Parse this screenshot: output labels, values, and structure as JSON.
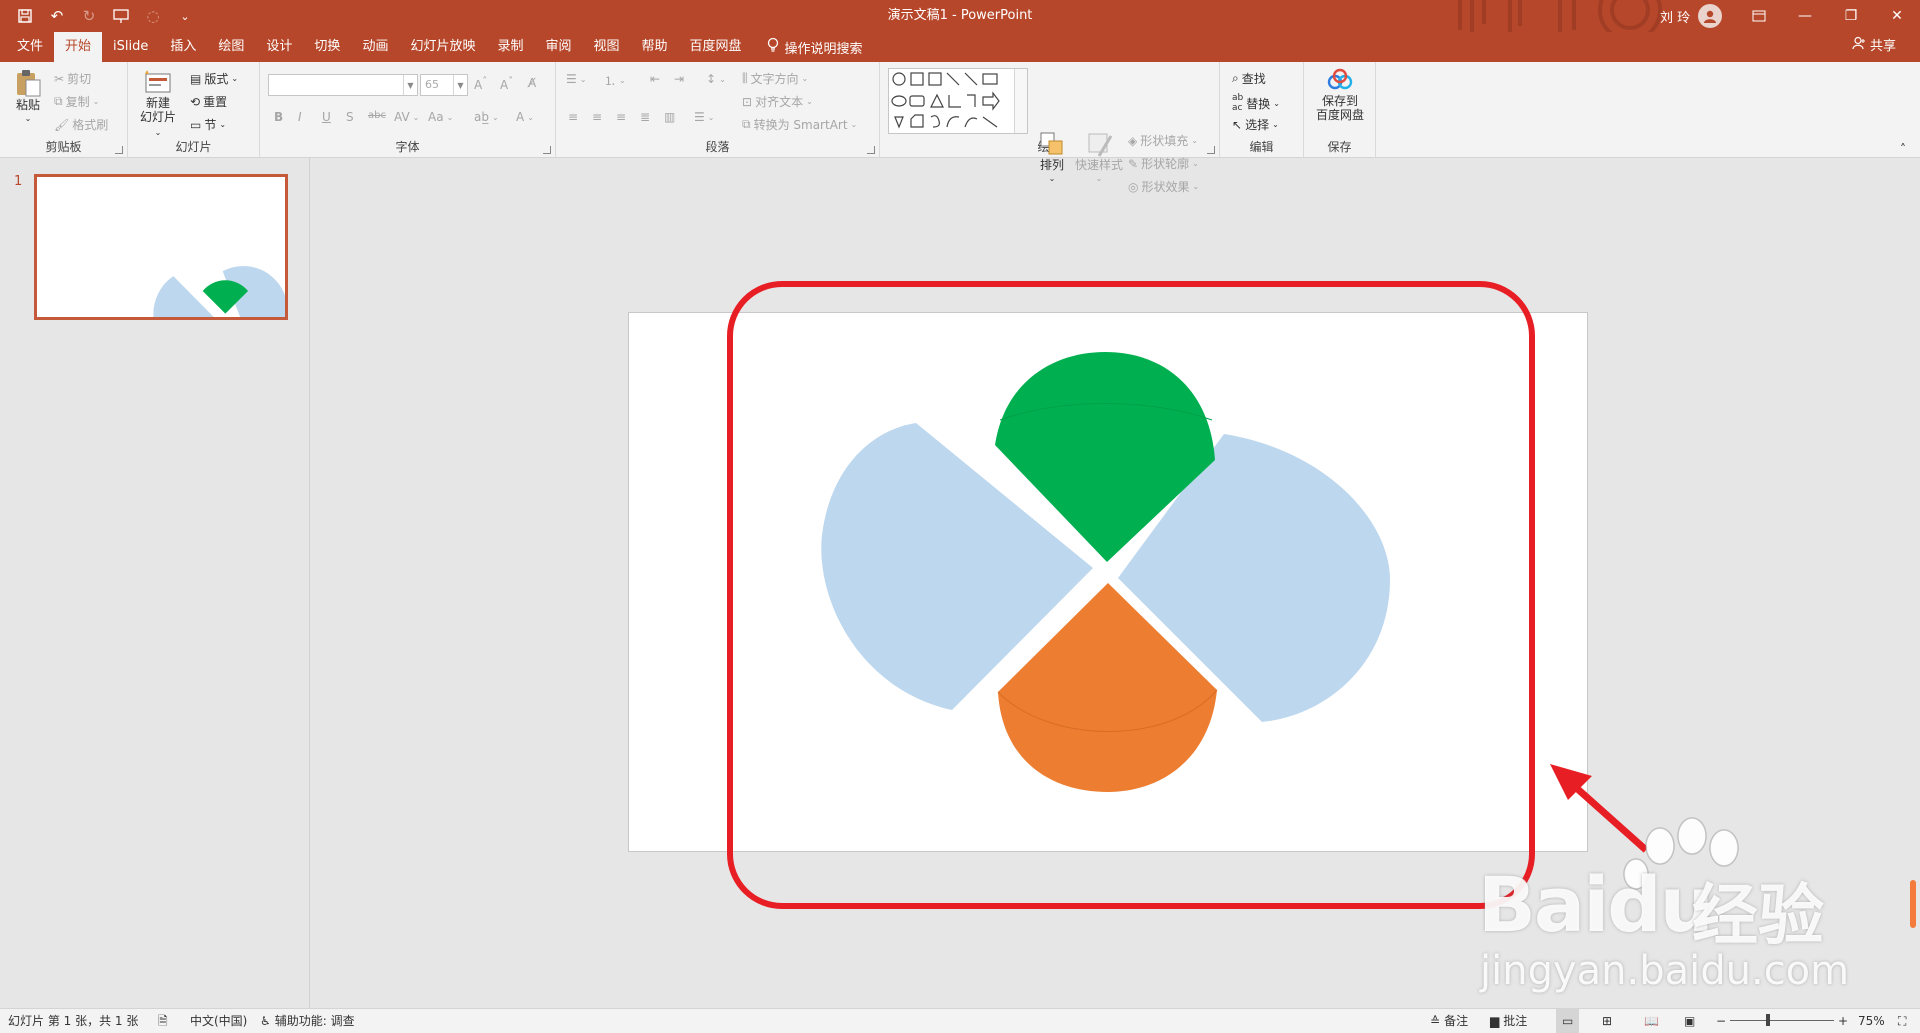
{
  "window": {
    "doc_title": "演示文稿1  -  PowerPoint",
    "user_name": "刘 玲",
    "share_label": "共享"
  },
  "tabs": [
    {
      "label": "文件"
    },
    {
      "label": "开始",
      "active": true
    },
    {
      "label": "iSlide"
    },
    {
      "label": "插入"
    },
    {
      "label": "绘图"
    },
    {
      "label": "设计"
    },
    {
      "label": "切换"
    },
    {
      "label": "动画"
    },
    {
      "label": "幻灯片放映"
    },
    {
      "label": "录制"
    },
    {
      "label": "审阅"
    },
    {
      "label": "视图"
    },
    {
      "label": "帮助"
    },
    {
      "label": "百度网盘"
    }
  ],
  "tell_me": "操作说明搜索",
  "ribbon": {
    "clipboard": {
      "label": "剪贴板",
      "paste": "粘贴",
      "cut": "剪切",
      "copy": "复制",
      "format_painter": "格式刷"
    },
    "slides": {
      "label": "幻灯片",
      "new_slide_1": "新建",
      "new_slide_2": "幻灯片",
      "layout": "版式",
      "reset": "重置",
      "section": "节"
    },
    "font": {
      "label": "字体",
      "font_size": "65"
    },
    "paragraph": {
      "label": "段落",
      "text_direction": "文字方向",
      "align_text": "对齐文本",
      "smartart": "转换为 SmartArt"
    },
    "drawing": {
      "label": "绘图",
      "arrange": "排列",
      "quick_styles": "快速样式",
      "shape_fill": "形状填充",
      "shape_outline": "形状轮廓",
      "shape_effects": "形状效果"
    },
    "editing": {
      "label": "编辑",
      "find": "查找",
      "replace": "替换",
      "select": "选择"
    },
    "save": {
      "label": "保存",
      "save_to_1": "保存到",
      "save_to_2": "百度网盘"
    }
  },
  "thumbnails": [
    {
      "number": "1"
    }
  ],
  "slide_shapes": {
    "colors": {
      "green": "#00b050",
      "orange": "#ed7d31",
      "light_blue": "#bdd7ee",
      "highlight_red": "#e81e25"
    }
  },
  "status": {
    "slide_info": "幻灯片 第 1 张，共 1 张",
    "language": "中文(中国)",
    "accessibility": "辅助功能: 调查",
    "notes": "备注",
    "comments": "批注",
    "zoom": "75%"
  },
  "watermark": {
    "brand": "Bai",
    "brand2": "du",
    "cn": "经验",
    "url": "jingyan.baidu.com"
  }
}
